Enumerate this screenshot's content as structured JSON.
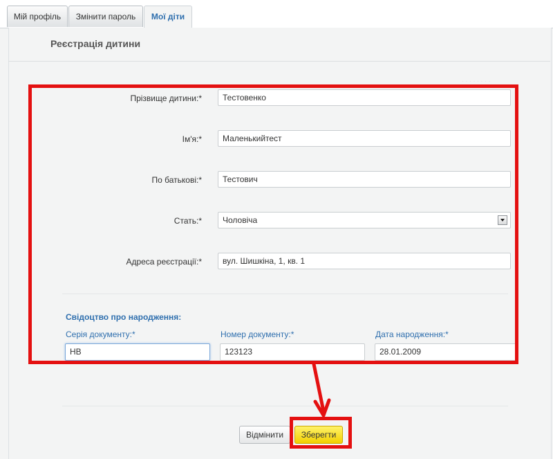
{
  "tabs": [
    {
      "label": "Мій профіль",
      "active": false
    },
    {
      "label": "Змінити пароль",
      "active": false
    },
    {
      "label": "Мої діти",
      "active": true
    }
  ],
  "panel": {
    "title": "Реєстрація дитини"
  },
  "form": {
    "surname": {
      "label": "Прізвище дитини:*",
      "value": "Тестовенко"
    },
    "name": {
      "label": "Ім'я:*",
      "value": "Маленькийтест"
    },
    "patronymic": {
      "label": "По батькові:*",
      "value": "Тестович"
    },
    "gender": {
      "label": "Стать:*",
      "value": "Чоловіча"
    },
    "address": {
      "label": "Адреса реєстрації:*",
      "value": "вул. Шишкіна, 1, кв. 1"
    }
  },
  "certificate": {
    "title": "Свідоцтво про народження:",
    "series": {
      "label": "Серія документу:*",
      "value": "НВ"
    },
    "number": {
      "label": "Номер документу:*",
      "value": "123123"
    },
    "birth_date": {
      "label": "Дата народження:*",
      "value": "28.01.2009"
    }
  },
  "actions": {
    "cancel_label": "Відмінити",
    "save_label": "Зберегти"
  },
  "colors": {
    "accent_blue": "#2f6fae",
    "highlight_red": "#e41010",
    "save_button_yellow": "#f2cf00"
  }
}
